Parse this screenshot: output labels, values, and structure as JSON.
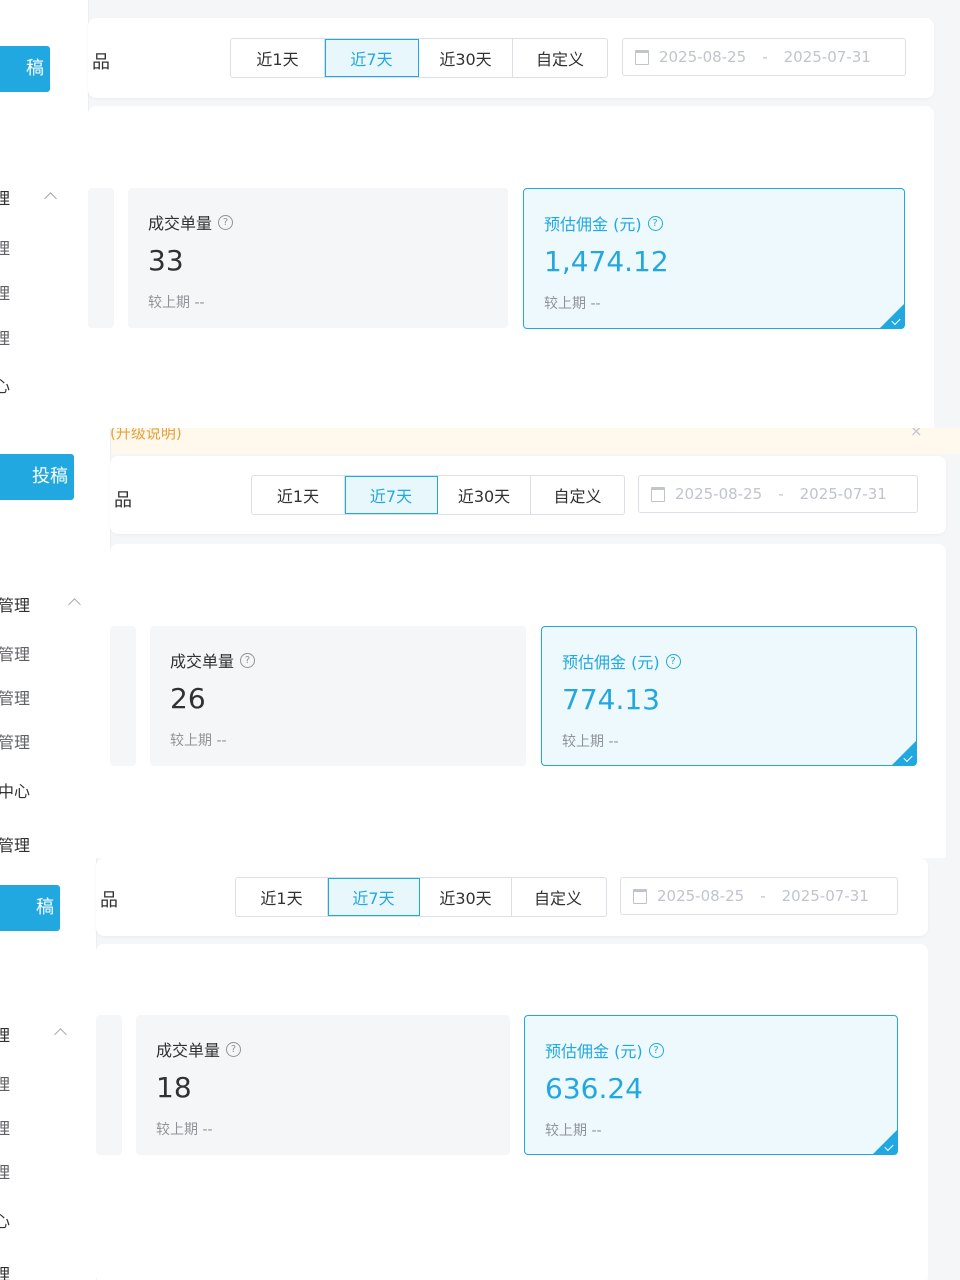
{
  "panels": [
    {
      "cta_label": "稿",
      "nav": [
        "理",
        "理",
        "理",
        "理",
        "心"
      ],
      "filter_label": "品",
      "ranges": [
        "近1天",
        "近7天",
        "近30天",
        "自定义"
      ],
      "active_range": "近7天",
      "date_start": "2025-08-25",
      "date_sep": "-",
      "date_end": "2025-07-31",
      "orders_title": "成交单量",
      "orders_value": "33",
      "orders_compare": "较上期 --",
      "commission_title": "预估佣金 (元)",
      "commission_value": "1,474.12",
      "commission_compare": "较上期 --"
    },
    {
      "notice_text": "(升级说明)",
      "notice_close": "×",
      "cta_label": "投稿",
      "nav": [
        "管理",
        "管理",
        "管理",
        "管理",
        "中心",
        "管理"
      ],
      "filter_label": "品",
      "ranges": [
        "近1天",
        "近7天",
        "近30天",
        "自定义"
      ],
      "active_range": "近7天",
      "date_start": "2025-08-25",
      "date_sep": "-",
      "date_end": "2025-07-31",
      "orders_title": "成交单量",
      "orders_value": "26",
      "orders_compare": "较上期 --",
      "commission_title": "预估佣金 (元)",
      "commission_value": "774.13",
      "commission_compare": "较上期 --"
    },
    {
      "cta_label": "稿",
      "nav": [
        "理",
        "理",
        "理",
        "理",
        "心",
        "理"
      ],
      "filter_label": "品",
      "ranges": [
        "近1天",
        "近7天",
        "近30天",
        "自定义"
      ],
      "active_range": "近7天",
      "date_start": "2025-08-25",
      "date_sep": "-",
      "date_end": "2025-07-31",
      "orders_title": "成交单量",
      "orders_value": "18",
      "orders_compare": "较上期 --",
      "commission_title": "预估佣金 (元)",
      "commission_value": "636.24",
      "commission_compare": "较上期 --"
    }
  ],
  "colors": {
    "accent": "#22a8e0",
    "highlight_bg": "#eef9fd",
    "card_bg": "#f5f6f8",
    "notice_text": "#e6a23c"
  },
  "icons": [
    "calendar-icon",
    "help-icon",
    "chevron-up-icon",
    "check-corner-icon",
    "close-icon"
  ]
}
